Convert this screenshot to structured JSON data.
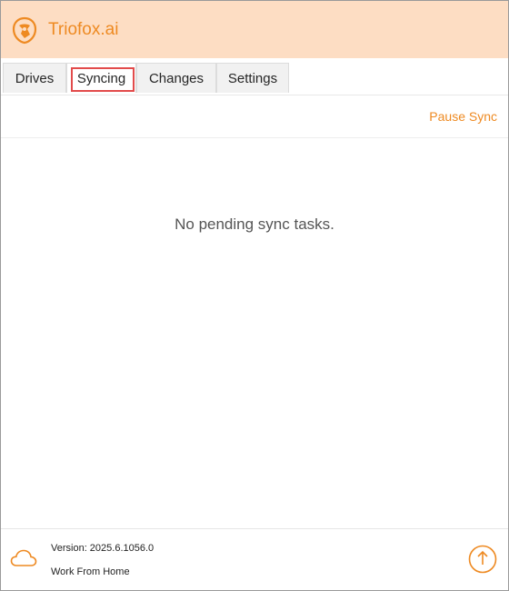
{
  "app": {
    "title": "Triofox.ai",
    "logo_icon": "triofox-logo-icon",
    "accent_color": "#ee8a22",
    "header_color": "#fdddc3"
  },
  "tabs": [
    {
      "label": "Drives",
      "active": false
    },
    {
      "label": "Syncing",
      "active": true,
      "highlighted": true
    },
    {
      "label": "Changes",
      "active": false
    },
    {
      "label": "Settings",
      "active": false
    }
  ],
  "toolbar": {
    "pause_sync_label": "Pause Sync"
  },
  "main": {
    "empty_message": "No pending sync tasks."
  },
  "footer": {
    "status_icon": "cloud-icon",
    "version_text": "Version: 2025.6.1056.0",
    "mode_text": "Work From Home",
    "upload_icon": "upload-arrow-icon"
  }
}
